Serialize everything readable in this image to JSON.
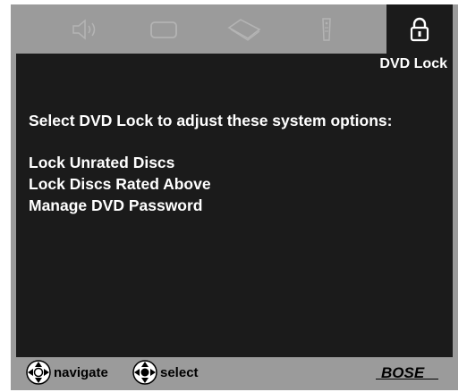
{
  "tabs": [
    {
      "icon": "speaker-icon",
      "active": false
    },
    {
      "icon": "tv-icon",
      "active": false
    },
    {
      "icon": "disc-icon",
      "active": false
    },
    {
      "icon": "remote-icon",
      "active": false
    },
    {
      "icon": "lock-icon",
      "active": true
    }
  ],
  "screen": {
    "title": "DVD Lock",
    "prompt": "Select DVD Lock to adjust these system options:",
    "menu_items": [
      "Lock Unrated Discs",
      "Lock Discs Rated Above",
      "Manage DVD Password"
    ]
  },
  "footer": {
    "navigate_label": "navigate",
    "select_label": "select",
    "brand": "BOSE"
  },
  "colors": {
    "panel": "#1b1b1b",
    "frame": "#9b9b9b",
    "text": "#ffffff"
  }
}
